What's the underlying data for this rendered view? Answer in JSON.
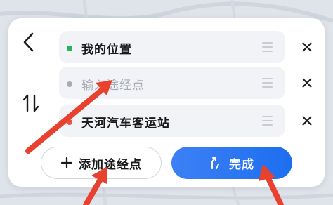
{
  "route_panel": {
    "waypoints": [
      {
        "text": "我的位置",
        "dot_color": "#27b35a",
        "is_placeholder": false
      },
      {
        "text": "输入途经点",
        "dot_color": "#a7abb3",
        "is_placeholder": true
      },
      {
        "text": "天河汽车客运站",
        "dot_color": "#e9524a",
        "is_placeholder": false
      }
    ],
    "add_waypoint_label": "添加途经点",
    "done_label": "完成"
  },
  "colors": {
    "accent_blue": "#1d6ef0",
    "annotation_red": "#e8422f"
  },
  "icons": {
    "back": "chevron-left",
    "swap": "swap-vertical",
    "drag": "drag-handle",
    "close": "close-x",
    "add": "plus",
    "done": "route-arrow"
  }
}
